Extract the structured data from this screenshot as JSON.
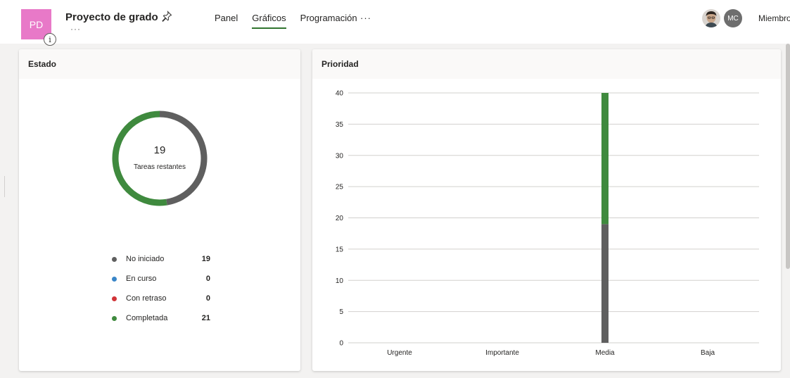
{
  "header": {
    "plan_initials": "PD",
    "info_glyph": "i",
    "plan_title": "Proyecto de grado",
    "title_more": "···",
    "tabs": [
      {
        "label": "Panel",
        "active": false
      },
      {
        "label": "Gráficos",
        "active": true
      },
      {
        "label": "Programación",
        "active": false
      }
    ],
    "more_tabs": "···",
    "member_initials": "MC",
    "members_label": "Miembros",
    "icons": [
      "pin-icon",
      "info-icon",
      "more-icon",
      "user-photo-avatar"
    ]
  },
  "status_card": {
    "title": "Estado",
    "remaining_count": "19",
    "remaining_label": "Tareas restantes",
    "legend": [
      {
        "label": "No iniciado",
        "value": "19",
        "color": "#5f5f5f"
      },
      {
        "label": "En curso",
        "value": "0",
        "color": "#3a86c8"
      },
      {
        "label": "Con retraso",
        "value": "0",
        "color": "#d13438"
      },
      {
        "label": "Completada",
        "value": "21",
        "color": "#3f8a3e"
      }
    ]
  },
  "priority_card": {
    "title": "Prioridad"
  },
  "colors": {
    "accent_green": "#31752f",
    "not_started": "#5f5f5f",
    "completed": "#3f8a3e",
    "tile_pink": "#e879c8"
  },
  "chart_data": [
    {
      "type": "pie",
      "subtype": "donut",
      "title": "Estado",
      "center_text": "19",
      "center_label": "Tareas restantes",
      "categories": [
        "No iniciado",
        "En curso",
        "Con retraso",
        "Completada"
      ],
      "values": [
        19,
        0,
        0,
        21
      ],
      "colors": [
        "#5f5f5f",
        "#3a86c8",
        "#d13438",
        "#3f8a3e"
      ]
    },
    {
      "type": "bar",
      "stacked": true,
      "title": "Prioridad",
      "categories": [
        "Urgente",
        "Importante",
        "Media",
        "Baja"
      ],
      "series": [
        {
          "values": [
            0,
            0,
            19,
            0
          ],
          "color": "#5f5f5f"
        },
        {
          "values": [
            0,
            0,
            21,
            0
          ],
          "color": "#3f8a3e"
        }
      ],
      "ylim": [
        0,
        40
      ],
      "yticks": [
        "0",
        "5",
        "10",
        "15",
        "20",
        "25",
        "30",
        "35",
        "40"
      ],
      "grid": true
    }
  ]
}
